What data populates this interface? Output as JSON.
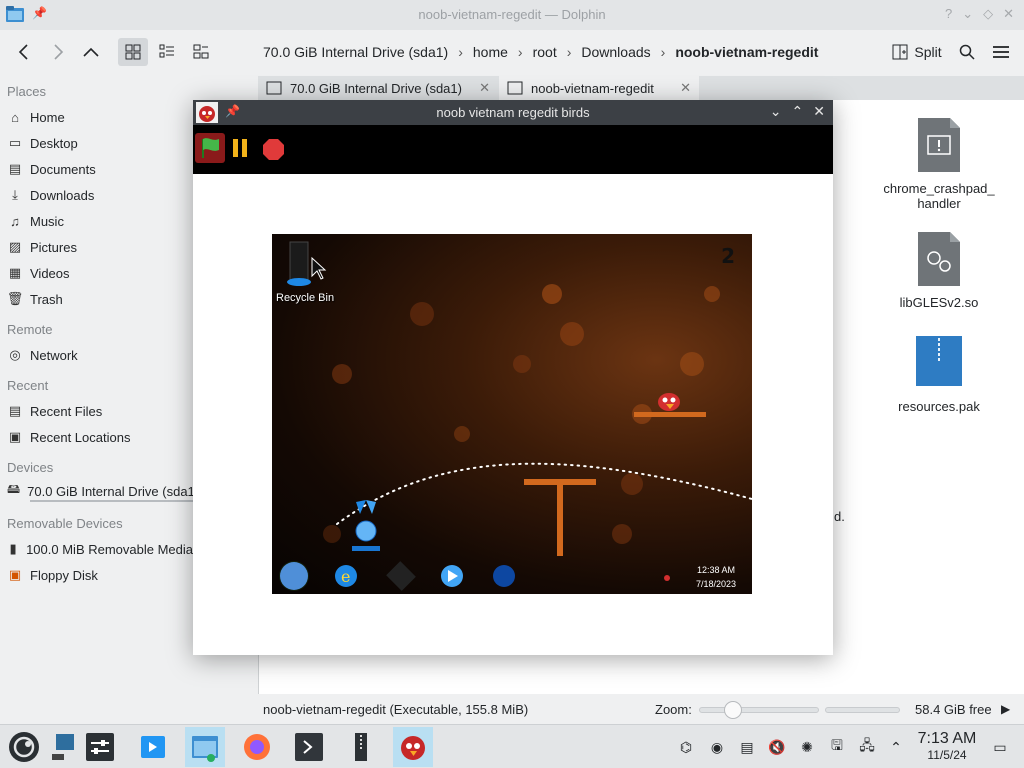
{
  "window": {
    "title": "noob-vietnam-regedit — Dolphin",
    "controls": [
      "?",
      "⌄",
      "◇",
      "✕"
    ]
  },
  "toolbar": {
    "breadcrumbs": [
      "70.0 GiB Internal Drive (sda1)",
      "home",
      "root",
      "Downloads",
      "noob-vietnam-regedit"
    ],
    "split_label": "Split"
  },
  "sidebar": {
    "places_title": "Places",
    "places": [
      "Home",
      "Desktop",
      "Documents",
      "Downloads",
      "Music",
      "Pictures",
      "Videos",
      "Trash"
    ],
    "remote_title": "Remote",
    "remote": [
      "Network"
    ],
    "recent_title": "Recent",
    "recent": [
      "Recent Files",
      "Recent Locations"
    ],
    "devices_title": "Devices",
    "devices": [
      "70.0 GiB Internal Drive (sda1)"
    ],
    "removable_title": "Removable Devices",
    "removable": [
      "100.0 MiB Removable Media",
      "Floppy Disk"
    ]
  },
  "tabs": [
    {
      "label": "70.0 GiB Internal Drive (sda1)"
    },
    {
      "label": "noob-vietnam-regedit"
    }
  ],
  "files": [
    {
      "name_line1": "chrome_crashpad_",
      "name_line2": "handler",
      "icon": "executable-file-icon"
    },
    {
      "name_line1": "libGLESv2.so",
      "name_line2": "",
      "icon": "shared-library-icon"
    },
    {
      "name_line1": "resources.pak",
      "name_line2": "",
      "icon": "archive-file-icon"
    }
  ],
  "behind_text": "d.",
  "statusbar": {
    "selection": "noob-vietnam-regedit (Executable, 155.8 MiB)",
    "zoom_label": "Zoom:",
    "free_space": "58.4 GiB free"
  },
  "game": {
    "title": "noob vietnam regedit birds",
    "score": "2",
    "recycle_bin_label": "Recycle Bin",
    "clock_time": "12:38 AM",
    "clock_date": "7/18/2023"
  },
  "panel": {
    "time": "7:13 AM",
    "date": "11/5/24"
  },
  "colors": {
    "accent": "#3daee9",
    "active_task": "#b9dff2",
    "game_title_bg": "#3c4045"
  }
}
